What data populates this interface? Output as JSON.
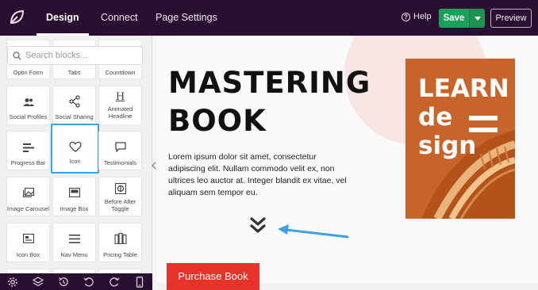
{
  "topbar": {
    "tabs": [
      {
        "label": "Design",
        "active": true
      },
      {
        "label": "Connect",
        "active": false
      },
      {
        "label": "Page Settings",
        "active": false
      }
    ],
    "help_label": "Help",
    "help_icon_glyph": "?",
    "save_label": "Save",
    "preview_label": "Preview"
  },
  "sidebar": {
    "search_placeholder": "Search blocks...",
    "blocks": [
      {
        "label": "Optin Form",
        "icon": "optin-form-icon"
      },
      {
        "label": "Tabs",
        "icon": "tabs-icon"
      },
      {
        "label": "Countdown",
        "icon": "countdown-icon"
      },
      {
        "label": "Social Profiles",
        "icon": "users-icon"
      },
      {
        "label": "Social Sharing",
        "icon": "share-icon"
      },
      {
        "label": "Animated Headline",
        "icon": "heading-icon"
      },
      {
        "label": "Progress Bar",
        "icon": "progress-bar-icon"
      },
      {
        "label": "Icon",
        "icon": "heart-icon",
        "selected": true
      },
      {
        "label": "Testimonials",
        "icon": "speech-bubble-icon"
      },
      {
        "label": "Image Carousel",
        "icon": "image-carousel-icon"
      },
      {
        "label": "Image Box",
        "icon": "image-box-icon"
      },
      {
        "label": "Before After Toggle",
        "icon": "before-after-icon"
      },
      {
        "label": "Icon Box",
        "icon": "icon-box-icon"
      },
      {
        "label": "Nav Menu",
        "icon": "hamburger-menu-icon"
      },
      {
        "label": "Pricing Table",
        "icon": "pricing-table-icon"
      }
    ],
    "heading_icon_glyph": "H"
  },
  "bottombar": {
    "icons": [
      "settings-gear-icon",
      "layers-icon",
      "history-icon",
      "undo-icon",
      "redo-icon",
      "mobile-preview-icon"
    ]
  },
  "canvas": {
    "headline_line1": "MASTERING",
    "headline_line2": "BOOK",
    "body_text": "Lorem ipsum dolor sit amet, consectetur adipiscing elit. Nullam commodo velit ex, non ultrices leo auctor at. Integer blandit ex vitae, vel aliquam sem tempor eu.",
    "book_cover": {
      "line1": "LEARN",
      "line2": "de",
      "line3": "sign"
    },
    "purchase_label": "Purchase Book"
  },
  "colors": {
    "topbar_bg": "#2a1030",
    "save_green": "#1aa05a",
    "selection_blue": "#3aa3e0",
    "purchase_red": "#e8332a",
    "book_orange": "#c8642a"
  }
}
